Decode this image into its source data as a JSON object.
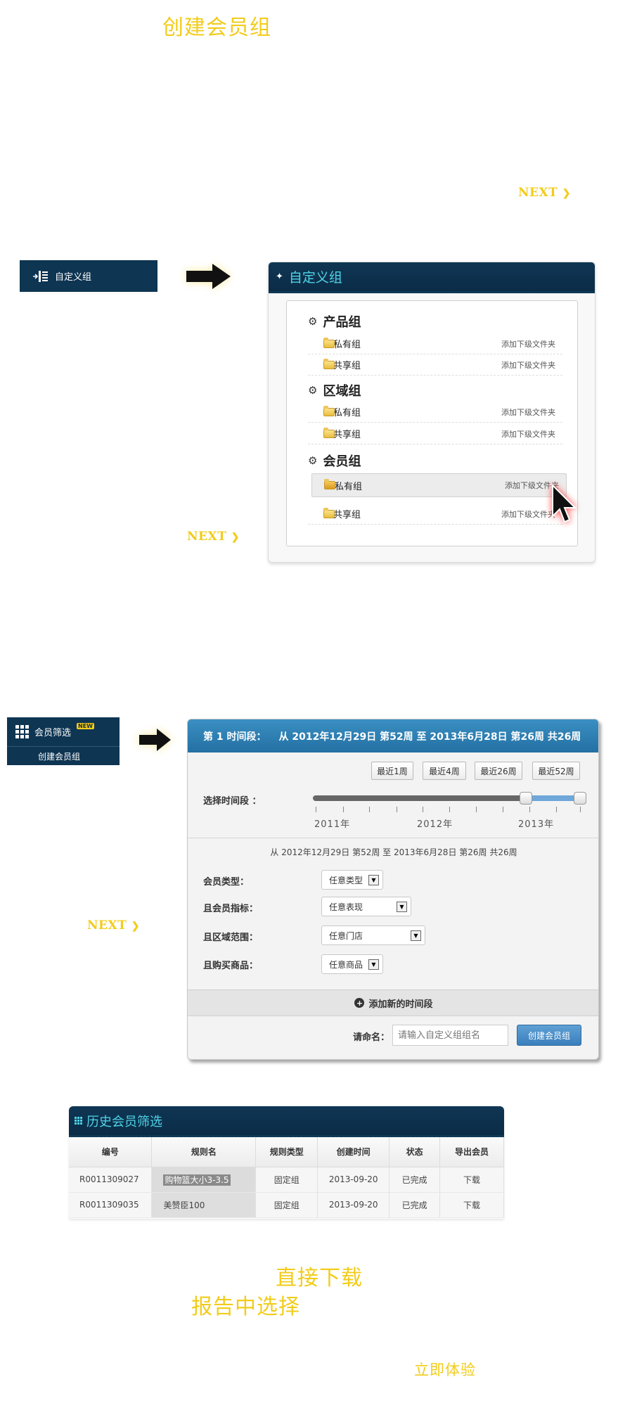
{
  "hero": {
    "title": "创建会员组",
    "next1": "NEXT",
    "next2": "NEXT",
    "next3": "NEXT"
  },
  "sidebar1": {
    "label": "自定义组"
  },
  "custom_panel": {
    "title": "自定义组",
    "groups": [
      {
        "name": "产品组",
        "items": [
          {
            "name": "私有组",
            "action": "添加下级文件夹"
          },
          {
            "name": "共享组",
            "action": "添加下级文件夹"
          }
        ]
      },
      {
        "name": "区域组",
        "items": [
          {
            "name": "私有组",
            "action": "添加下级文件夹"
          },
          {
            "name": "共享组",
            "action": "添加下级文件夹"
          }
        ]
      },
      {
        "name": "会员组",
        "items": [
          {
            "name": "私有组",
            "action": "添加下级文件夹"
          },
          {
            "name": "共享组",
            "action": "添加下级文件夹"
          }
        ]
      }
    ]
  },
  "sidebar2": {
    "menu_label": "会员筛选",
    "badge": "NEW",
    "sub_label": "创建会员组"
  },
  "filter_panel": {
    "header_period": "第 1 时间段：",
    "header_range": "从 2012年12月29日 第52周 至 2013年6月28日 第26周 共26周",
    "quick_buttons": [
      "最近1周",
      "最近4周",
      "最近26周",
      "最近52周"
    ],
    "period_label": "选择时间段 ：",
    "years": [
      "2011年",
      "2012年",
      "2013年"
    ],
    "range_text": "从 2012年12月29日 第52周 至 2013年6月28日 第26周 共26周",
    "fields": [
      {
        "label": "会员类型：",
        "value": "任意类型"
      },
      {
        "label": "且会员指标：",
        "value": "任意表现"
      },
      {
        "label": "且区域范围：",
        "value": "任意门店"
      },
      {
        "label": "且购买商品：",
        "value": "任意商品"
      }
    ],
    "add_period": "添加新的时间段",
    "name_label": "请命名：",
    "name_placeholder": "请输入自定义组组名",
    "create_button": "创建会员组"
  },
  "history": {
    "title": "历史会员筛选",
    "columns": [
      "编号",
      "规则名",
      "规则类型",
      "创建时间",
      "状态",
      "导出会员"
    ],
    "rows": [
      [
        "R0011309027",
        "购物篮大小3-3.5",
        "固定组",
        "2013-09-20",
        "已完成",
        "下载"
      ],
      [
        "R0011309035",
        "美赞臣100",
        "固定组",
        "2013-09-20",
        "已完成",
        "下载"
      ]
    ]
  },
  "footer": {
    "direct_download": "直接下载",
    "report_select": "报告中选择",
    "try_now": "立即体验"
  }
}
